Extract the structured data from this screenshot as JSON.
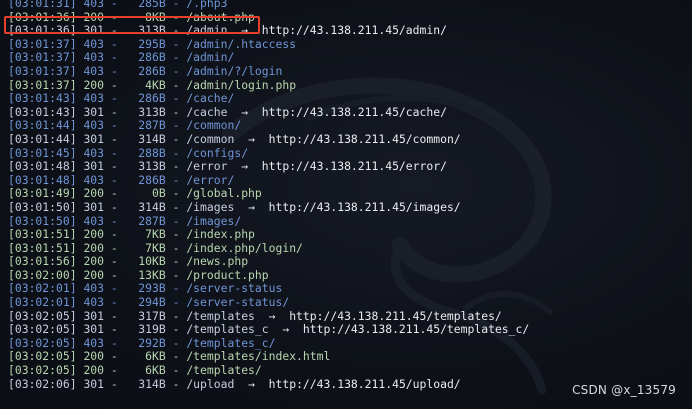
{
  "log_lines": [
    {
      "time": "[03:01:31]",
      "status": "403",
      "size": "285B",
      "path": "/.php3",
      "redirect": null
    },
    {
      "time": "[03:01:36]",
      "status": "200",
      "size": "8KB",
      "path": "/about.php",
      "redirect": null
    },
    {
      "time": "[03:01:36]",
      "status": "301",
      "size": "313B",
      "path": "/admin",
      "redirect": "http://43.138.211.45/admin/"
    },
    {
      "time": "[03:01:37]",
      "status": "403",
      "size": "295B",
      "path": "/admin/.htaccess",
      "redirect": null
    },
    {
      "time": "[03:01:37]",
      "status": "403",
      "size": "286B",
      "path": "/admin/",
      "redirect": null
    },
    {
      "time": "[03:01:37]",
      "status": "403",
      "size": "286B",
      "path": "/admin/?/login",
      "redirect": null
    },
    {
      "time": "[03:01:37]",
      "status": "200",
      "size": "4KB",
      "path": "/admin/login.php",
      "redirect": null
    },
    {
      "time": "[03:01:43]",
      "status": "403",
      "size": "286B",
      "path": "/cache/",
      "redirect": null
    },
    {
      "time": "[03:01:43]",
      "status": "301",
      "size": "313B",
      "path": "/cache",
      "redirect": "http://43.138.211.45/cache/"
    },
    {
      "time": "[03:01:44]",
      "status": "403",
      "size": "287B",
      "path": "/common/",
      "redirect": null
    },
    {
      "time": "[03:01:44]",
      "status": "301",
      "size": "314B",
      "path": "/common",
      "redirect": "http://43.138.211.45/common/"
    },
    {
      "time": "[03:01:45]",
      "status": "403",
      "size": "288B",
      "path": "/configs/",
      "redirect": null
    },
    {
      "time": "[03:01:48]",
      "status": "301",
      "size": "313B",
      "path": "/error",
      "redirect": "http://43.138.211.45/error/"
    },
    {
      "time": "[03:01:48]",
      "status": "403",
      "size": "286B",
      "path": "/error/",
      "redirect": null
    },
    {
      "time": "[03:01:49]",
      "status": "200",
      "size": "0B",
      "path": "/global.php",
      "redirect": null
    },
    {
      "time": "[03:01:50]",
      "status": "301",
      "size": "314B",
      "path": "/images",
      "redirect": "http://43.138.211.45/images/"
    },
    {
      "time": "[03:01:50]",
      "status": "403",
      "size": "287B",
      "path": "/images/",
      "redirect": null
    },
    {
      "time": "[03:01:51]",
      "status": "200",
      "size": "7KB",
      "path": "/index.php",
      "redirect": null
    },
    {
      "time": "[03:01:51]",
      "status": "200",
      "size": "7KB",
      "path": "/index.php/login/",
      "redirect": null
    },
    {
      "time": "[03:01:56]",
      "status": "200",
      "size": "10KB",
      "path": "/news.php",
      "redirect": null
    },
    {
      "time": "[03:02:00]",
      "status": "200",
      "size": "13KB",
      "path": "/product.php",
      "redirect": null
    },
    {
      "time": "[03:02:01]",
      "status": "403",
      "size": "293B",
      "path": "/server-status",
      "redirect": null
    },
    {
      "time": "[03:02:01]",
      "status": "403",
      "size": "294B",
      "path": "/server-status/",
      "redirect": null
    },
    {
      "time": "[03:02:05]",
      "status": "301",
      "size": "317B",
      "path": "/templates",
      "redirect": "http://43.138.211.45/templates/"
    },
    {
      "time": "[03:02:05]",
      "status": "301",
      "size": "319B",
      "path": "/templates_c",
      "redirect": "http://43.138.211.45/templates_c/"
    },
    {
      "time": "[03:02:05]",
      "status": "403",
      "size": "292B",
      "path": "/templates_c/",
      "redirect": null
    },
    {
      "time": "[03:02:05]",
      "status": "200",
      "size": "6KB",
      "path": "/templates/index.html",
      "redirect": null
    },
    {
      "time": "[03:02:05]",
      "status": "200",
      "size": "6KB",
      "path": "/templates/",
      "redirect": null
    },
    {
      "time": "[03:02:06]",
      "status": "301",
      "size": "314B",
      "path": "/upload",
      "redirect": "http://43.138.211.45/upload/"
    }
  ],
  "arrow_glyph": "→",
  "highlighted_path": "/about.php",
  "watermark": "CSDN @x_13579",
  "colors": {
    "ok": "#b8d6b0",
    "redirect": "#c8cde0",
    "forbidden": "#6f95d6",
    "highlight": "#e5402b"
  }
}
